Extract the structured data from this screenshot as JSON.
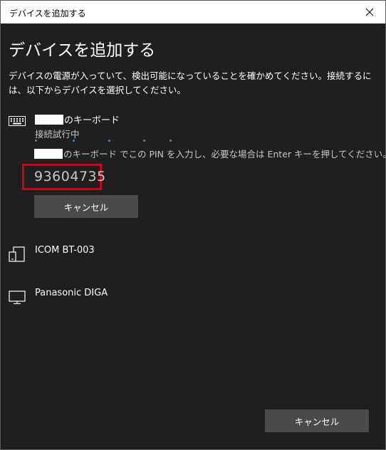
{
  "window": {
    "title": "デバイスを追加する",
    "close_icon": "close-icon"
  },
  "dialog": {
    "heading": "デバイスを追加する",
    "description": "デバイスの電源が入っていて、検出可能になっていることを確かめてください。接続するには、以下からデバイスを選択してください。"
  },
  "devices": [
    {
      "icon": "keyboard-icon",
      "name_suffix": "のキーボード",
      "status": "接続試行中",
      "instruction_suffix": "のキーボード でこの PIN を入力し、必要な場合は Enter キーを押してください。",
      "pin": "93604735",
      "cancel_label": "キャンセル"
    },
    {
      "icon": "device-icon",
      "name": "ICOM BT-003"
    },
    {
      "icon": "monitor-icon",
      "name": "Panasonic DIGA"
    }
  ],
  "footer": {
    "cancel_label": "キャンセル"
  },
  "colors": {
    "background": "#1f1f1f",
    "button": "#4a4a4a",
    "pin_highlight": "#d0021b",
    "progress_dot": "#2f8fd8",
    "secondary_text": "#c8c8c8"
  }
}
